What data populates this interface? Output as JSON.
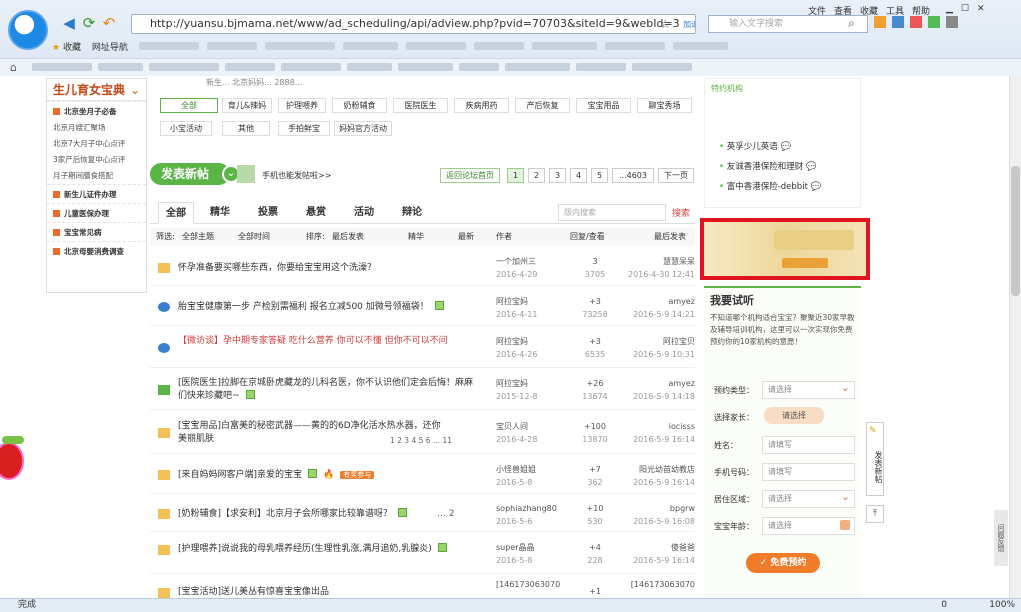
{
  "browser": {
    "url": "http://yuansu.bjmama.net/www/ad_scheduling/api/adview.php?pvid=70703&siteId=9&webId=3",
    "url_suffix": "加速器",
    "search_placeholder": "输入文字搜索",
    "menu": [
      "文件",
      "查看",
      "收藏",
      "工具",
      "帮助"
    ],
    "fav_label": "收藏",
    "fav_item1": "网址导航",
    "status_text": "完成",
    "zoom": "100%",
    "status_count": "0"
  },
  "sidebar": {
    "title": "生儿育女宝典",
    "sec1": "北京坐月子必备",
    "items": [
      "北京月嫂汇聚场",
      "北京7大月子中心点评",
      "3家产后恢复中心点评",
      "月子期间膳食搭配"
    ],
    "sec2": "新生儿证件办理",
    "sec3": "儿童医保办理",
    "sec4": "宝宝常见病",
    "sec5": "北京母婴消费调查"
  },
  "top_partial": "新生... 北京妈妈... 2888...",
  "tags": [
    "全部",
    "育儿&辣妈",
    "护理喂养",
    "奶粉辅食",
    "医院医生",
    "疾病用药",
    "产后恢复",
    "宝宝用品",
    "聊宝秀场",
    "小宝活动",
    "其他",
    "手拍鲜宝",
    "妈妈官方活动"
  ],
  "post_button": "发表新帖",
  "mobile_post": "手机也能发帖啦>>",
  "pager": {
    "back": "返回论坛首页",
    "pages": [
      "1",
      "2",
      "3",
      "4",
      "5",
      "...4603"
    ],
    "next": "下一页"
  },
  "tabs": [
    "全部",
    "精华",
    "投票",
    "悬赏",
    "活动",
    "辩论"
  ],
  "board_search": "版内搜索",
  "board_search_btn": "搜索",
  "filter": {
    "filter": "筛选:",
    "topic": "全部主题",
    "time": "全部时间",
    "sort": "排序:",
    "sort_val": "最后发表",
    "digest": "精华",
    "newest": "最新",
    "author": "作者",
    "replies": "回复/查看",
    "last": "最后发表"
  },
  "threads": [
    {
      "title": "怀孕准备要买哪些东西，你要给宝宝用这个洗澡？",
      "author": "一个加州三",
      "date": "2016-4-29",
      "replies": "3",
      "views": "3705",
      "last_user": "慧慧呆呆",
      "last_time": "2016-4-30 12:41"
    },
    {
      "title": "胎宝宝健康第一步 产检别需福利 报名立减500 加微号领福袋！",
      "author": "阿拉宝妈",
      "date": "2016-4-11",
      "replies": "+3",
      "views": "73258",
      "last_user": "amyez",
      "last_time": "2016-5-9 14:21"
    },
    {
      "title": "【微访谈】孕中期专家答疑 吃什么营养 你可以不懂 但你不可以不问",
      "author": "阿拉宝妈",
      "date": "2016-4-26",
      "replies": "+3",
      "views": "6535",
      "last_user": "阿拉宝贝",
      "last_time": "2016-5-9 10:31"
    },
    {
      "title": "[医院医生]拉脚在京城卧虎藏龙的儿科名医，你不认识他们定会后悔！麻麻们快来珍藏吧~",
      "author": "阿拉宝妈",
      "date": "2015-12-8",
      "replies": "+26",
      "views": "13674",
      "last_user": "amyez",
      "last_time": "2016-5-9 14:18"
    },
    {
      "title": "[宝宝用品]白富美的秘密武器——黄的的6D净化活水热水器，还你美丽肌肤",
      "author": "宝贝人间",
      "date": "2016-4-28",
      "replies": "+100",
      "views": "13870",
      "last_user": "iocisss",
      "last_time": "2016-5-9 16:14"
    },
    {
      "title": "[来自妈妈网客户端]亲爱的宝宝",
      "author": "小怪兽姐姐",
      "date": "2016-5-8",
      "replies": "+7",
      "views": "362",
      "last_user": "阳光幼苗幼教店",
      "last_time": "2016-5-9 16:14"
    },
    {
      "title": "[奶粉辅食]【求安利】北京月子会所哪家比较靠谱呀？",
      "author": "sophiazhang80",
      "date": "2016-5-6",
      "replies": "+10",
      "views": "530",
      "last_user": "bpgrw",
      "last_time": "2016-5-9 16:08"
    },
    {
      "title": "[护理喂养]说说我的母乳喂养经历(生理性乳涨,满月追奶,乳腺炎)",
      "author": "super晶晶",
      "date": "2016-5-8",
      "replies": "+4",
      "views": "228",
      "last_user": "傻爸爸",
      "last_time": "2016-5-9 16:14"
    },
    {
      "title": "[宝宝活动]送儿美丛有惊喜宝宝像出品",
      "author": "[146173063070",
      "date": "",
      "replies": "+1",
      "views": "",
      "last_user": "[146173063070",
      "last_time": ""
    }
  ],
  "thread5_pages": "1 2 3 4 5 6 ... 11",
  "thread6_badge": "有奖参与",
  "right": {
    "top_title": "特约机构",
    "links": [
      "英孚少儿英语",
      "友诚香港保险和理财",
      "富中香港保险-debbit"
    ],
    "trial_title": "我要试听",
    "trial_desc": "不知道哪个机构适合宝宝？聚聚近30家早教及辅导培训机构，这里可以一次实现你免费预约你的10家机构的意愿！",
    "fields": [
      {
        "label": "预约类型：",
        "value": "请选择"
      },
      {
        "label": "选择家长：",
        "value": "请选择"
      },
      {
        "label": "姓名：",
        "value": "请填写"
      },
      {
        "label": "手机号码：",
        "value": "请填写"
      },
      {
        "label": "居住区域：",
        "value": "请选择"
      },
      {
        "label": "宝宝年龄：",
        "value": "请选择"
      }
    ],
    "submit": "免费预约",
    "float_post": "发表新帖",
    "float_side": "问题反馈"
  },
  "colors": {
    "green": "#5ab546",
    "orange": "#f07c2a",
    "red_ad": "#e0141e",
    "title_red": "#d23c3c"
  }
}
